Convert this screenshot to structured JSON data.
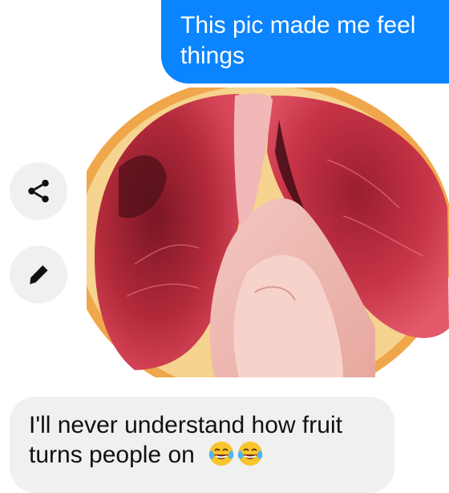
{
  "conversation": {
    "outgoing": {
      "line1": "This pic made me feel",
      "line2": "things"
    },
    "shared_photo": {
      "subject": "blood-orange-halved-with-fingers"
    },
    "side_actions": {
      "share_icon": "share-icon",
      "edit_icon": "pencil-icon"
    },
    "incoming": {
      "line1": "I'll never understand how fruit",
      "line2": "turns people on",
      "emojis": [
        "tears-of-joy-emoji",
        "tears-of-joy-emoji"
      ]
    }
  },
  "colors": {
    "outgoing_bubble": "#0a84ff",
    "incoming_bubble": "#f0f0f0",
    "action_button": "#f0f0f0",
    "text_dark": "#111111",
    "text_light": "#ffffff"
  }
}
